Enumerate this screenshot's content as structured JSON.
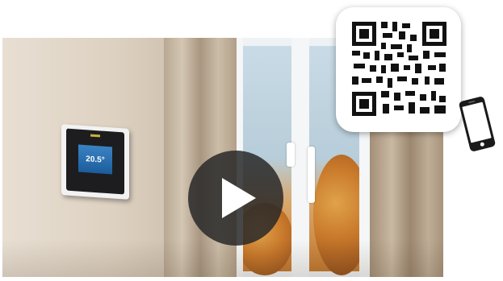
{
  "video": {
    "thermostat_display": "20.5°",
    "play_icon": "play-icon"
  },
  "qr": {
    "icon": "qr-code-icon"
  },
  "phone": {
    "icon": "smartphone-icon"
  },
  "colors": {
    "play_bg": "#282828",
    "card_bg": "#ffffff",
    "screen_blue": "#2a6fb0"
  }
}
